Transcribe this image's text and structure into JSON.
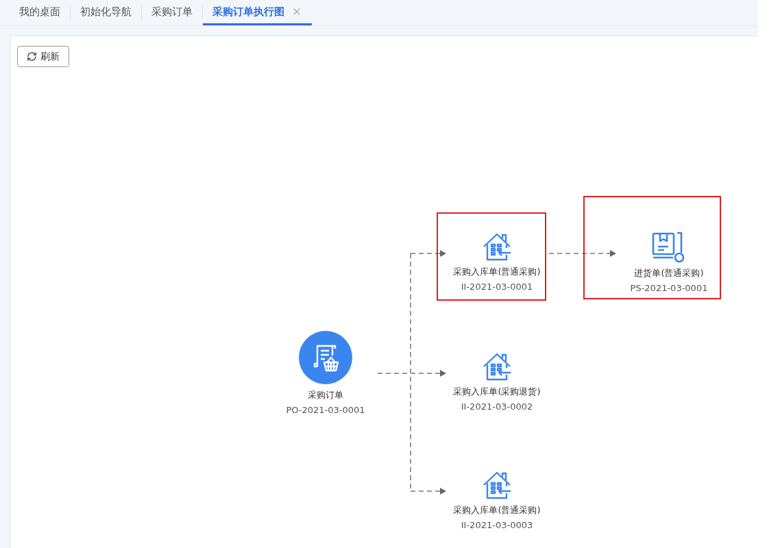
{
  "tabs": [
    {
      "label": "我的桌面",
      "selected": false,
      "closable": false
    },
    {
      "label": "初始化导航",
      "selected": false,
      "closable": false
    },
    {
      "label": "采购订单",
      "selected": false,
      "closable": false
    },
    {
      "label": "采购订单执行图",
      "selected": true,
      "closable": true
    }
  ],
  "toolbar": {
    "refresh_button": "刷新"
  },
  "diagram": {
    "source": {
      "kind": "order",
      "title": "采购订单",
      "code": "PO-2021-03-0001"
    },
    "documents": [
      {
        "kind": "inbound",
        "title": "采购入库单(普通采购)",
        "code": "II-2021-03-0001",
        "highlighted": true
      },
      {
        "kind": "receipt",
        "title": "进货单(普通采购)",
        "code": "PS-2021-03-0001",
        "highlighted": true
      },
      {
        "kind": "inbound",
        "title": "采购入库单(采购退货)",
        "code": "II-2021-03-0002",
        "highlighted": false
      },
      {
        "kind": "inbound",
        "title": "采购入库单(普通采购)",
        "code": "II-2021-03-0003",
        "highlighted": false
      }
    ]
  }
}
